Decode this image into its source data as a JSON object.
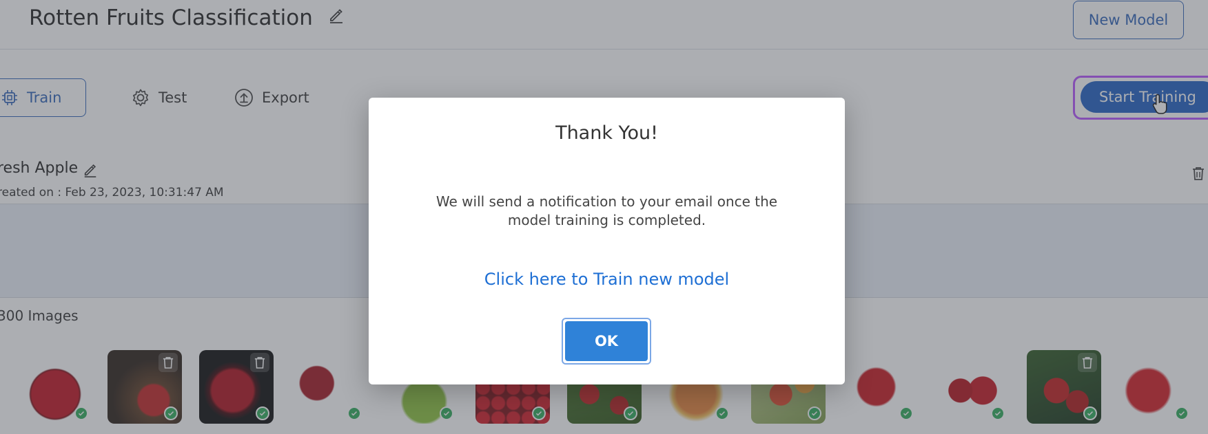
{
  "header": {
    "title": "Rotten Fruits Classification",
    "new_model_label": "New Model"
  },
  "tabs": [
    {
      "label": "Train",
      "active": true,
      "icon": "cpu-icon"
    },
    {
      "label": "Test",
      "active": false,
      "icon": "gear-icon"
    },
    {
      "label": "Export",
      "active": false,
      "icon": "upload-icon"
    }
  ],
  "start_training_label": "Start Training",
  "class_section": {
    "name": "resh Apple",
    "created": "reated on : Feb 23, 2023, 10:31:47 AM",
    "image_count": "300 Images"
  },
  "thumbnails": [
    {
      "kind": "red-apple-white"
    },
    {
      "kind": "apple-dark-wood"
    },
    {
      "kind": "apple-black"
    },
    {
      "kind": "apple-halves"
    },
    {
      "kind": "green-apple"
    },
    {
      "kind": "many-red-apples"
    },
    {
      "kind": "apples-on-tree"
    },
    {
      "kind": "yellow-red-apple"
    },
    {
      "kind": "apples-branch"
    },
    {
      "kind": "red-apple-leaf"
    },
    {
      "kind": "two-red-apples"
    },
    {
      "kind": "apples-tree-dark"
    },
    {
      "kind": "red-apple-glossy"
    }
  ],
  "modal": {
    "title": "Thank You!",
    "message": "We will send a notification to your email once the model training is completed.",
    "link": "Click here to Train new model",
    "ok_label": "OK"
  },
  "colors": {
    "accent": "#1f5fc4",
    "link": "#1e6fd4",
    "ok_button": "#2f82d8",
    "focus_ring": "#b652ff",
    "success": "#2eab5a"
  }
}
